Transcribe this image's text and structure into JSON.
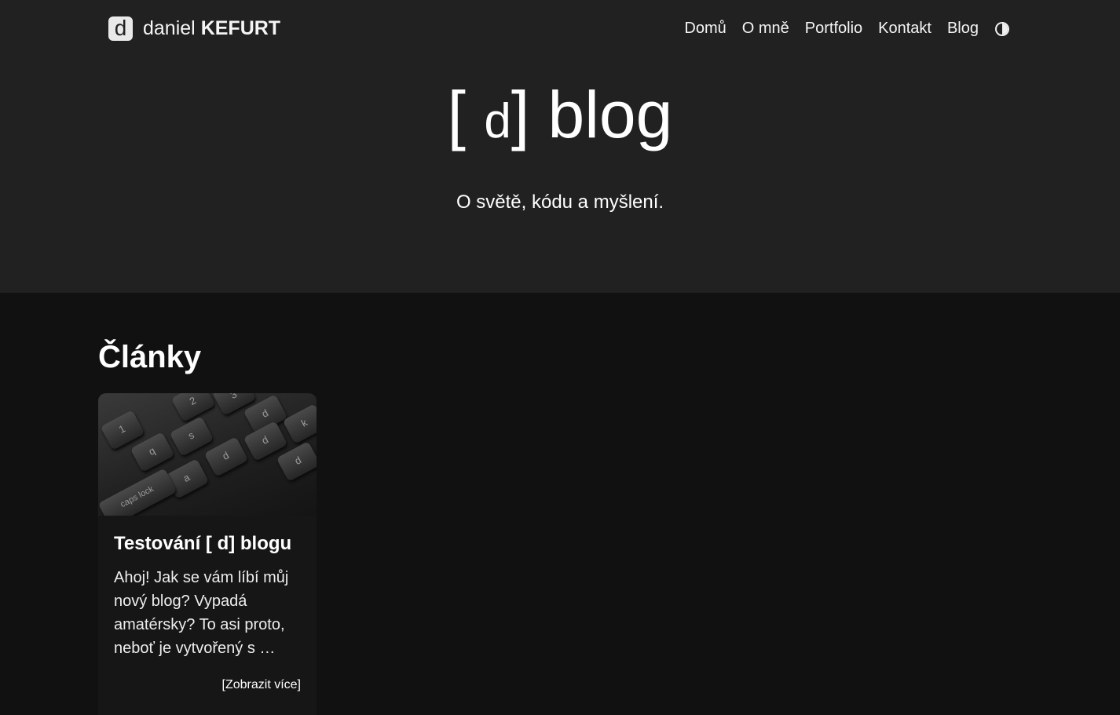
{
  "brand": {
    "logo_letter": "d",
    "first_name": "daniel",
    "last_name": "KEFURT"
  },
  "nav": {
    "items": [
      {
        "label": "Domů"
      },
      {
        "label": "O mně"
      },
      {
        "label": "Portfolio"
      },
      {
        "label": "Kontakt"
      },
      {
        "label": "Blog"
      }
    ],
    "theme_toggle_icon": "contrast-half-circle-icon"
  },
  "hero": {
    "title_open": "[",
    "title_letter": "d",
    "title_rest": "] blog",
    "subtitle": "O světě, kódu a myšlení."
  },
  "articles": {
    "heading": "Články",
    "items": [
      {
        "image": "keyboard-photo",
        "image_keys": [
          "2",
          "3",
          "d",
          "k",
          "1",
          "s",
          "d",
          "q",
          "d",
          "d",
          "a",
          "caps lock"
        ],
        "title": "Testování [ d] blogu",
        "excerpt": "Ahoj! Jak se vám líbí můj nový blog? Vypadá amatérsky? To asi proto, neboť je vytvořený s …",
        "more_label": "[Zobrazit více]"
      }
    ]
  },
  "colors": {
    "hero_background": "#212121",
    "page_background": "#111111",
    "card_background": "#161616",
    "text": "#ffffff"
  }
}
